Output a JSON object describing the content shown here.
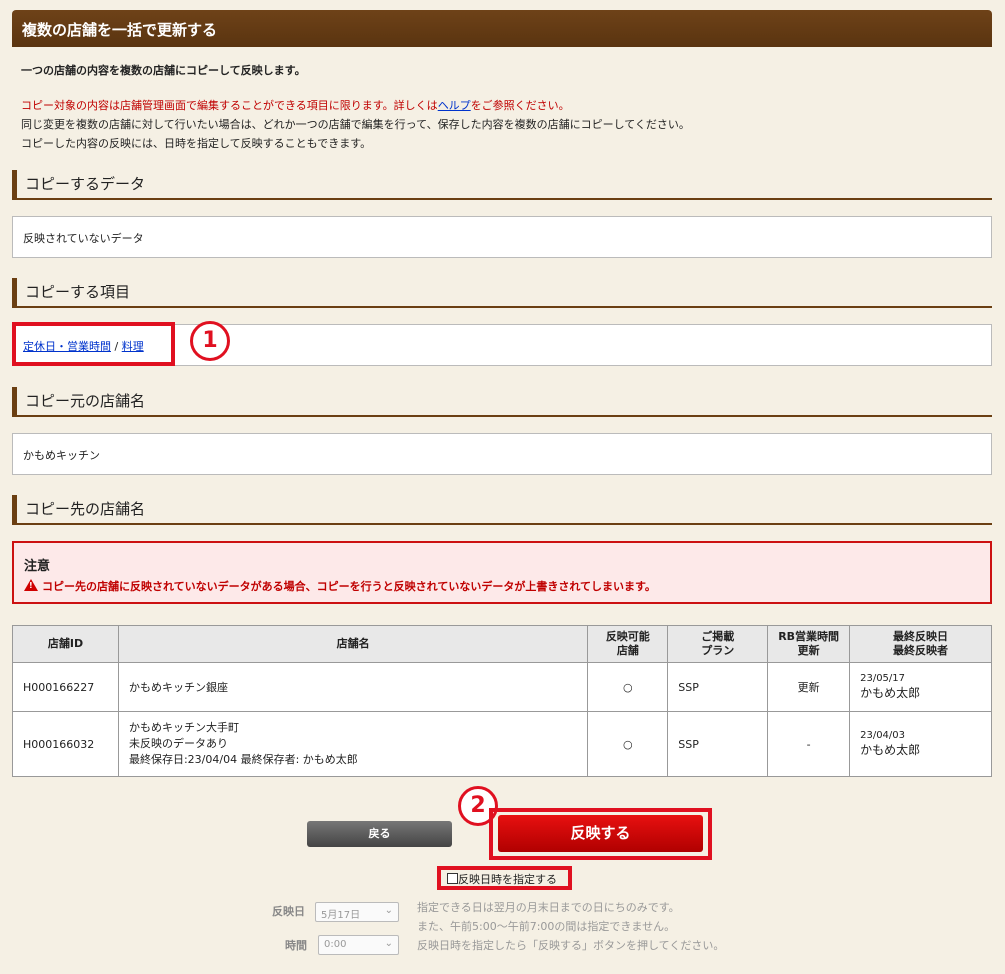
{
  "page": {
    "title": "複数の店舗を一括で更新する",
    "intro": "一つの店舗の内容を複数の店舗にコピーして反映します。",
    "note_red_1": "コピー対象の内容は店舗管理画面で編集することができる項目に限ります。詳しくは",
    "note_link": "ヘルプ",
    "note_red_2": "をご参照ください。",
    "note_2": "同じ変更を複数の店舗に対して行いたい場合は、どれか一つの店舗で編集を行って、保存した内容を複数の店舗にコピーしてください。",
    "note_3": "コピーした内容の反映には、日時を指定して反映することもできます。"
  },
  "sections": {
    "copy_data": {
      "heading": "コピーするデータ",
      "value": "反映されていないデータ"
    },
    "copy_items": {
      "heading": "コピーする項目",
      "link1": "定休日・営業時間",
      "sep": " / ",
      "link2": "料理"
    },
    "source_store": {
      "heading": "コピー元の店舗名",
      "value": "かもめキッチン"
    },
    "target_store": {
      "heading": "コピー先の店舗名"
    }
  },
  "caution": {
    "title": "注意",
    "message": "コピー先の店舗に反映されていないデータがある場合、コピーを行うと反映されていないデータが上書きされてしまいます。"
  },
  "table": {
    "headers": {
      "id": "店舗ID",
      "name": "店舗名",
      "reflectable_1": "反映可能",
      "reflectable_2": "店舗",
      "plan_1": "ご掲載",
      "plan_2": "プラン",
      "rb_1": "RB営業時間",
      "rb_2": "更新",
      "last_1": "最終反映日",
      "last_2": "最終反映者"
    },
    "rows": [
      {
        "id": "H000166227",
        "name": "かもめキッチン銀座",
        "name_sub1": "",
        "name_sub2": "",
        "reflectable": "○",
        "plan": "SSP",
        "rb": "更新",
        "last_date": "23/05/17",
        "last_user": "かもめ太郎"
      },
      {
        "id": "H000166032",
        "name": "かもめキッチン大手町",
        "name_sub1": "未反映のデータあり",
        "name_sub2": "最終保存日:23/04/04 最終保存者: かもめ太郎",
        "reflectable": "○",
        "plan": "SSP",
        "rb": "-",
        "last_date": "23/04/03",
        "last_user": "かもめ太郎"
      }
    ]
  },
  "annotations": {
    "one": "1",
    "two": "2"
  },
  "buttons": {
    "back": "戻る",
    "apply": "反映する"
  },
  "schedule": {
    "checkbox_label": "反映日時を指定する",
    "date_label": "反映日",
    "date_value": "5月17日",
    "time_label": "時間",
    "time_value": "0:00",
    "note1": "指定できる日は翌月の月末日までの日にちのみです。",
    "note2": "また、午前5:00〜午前7:00の間は指定できません。",
    "note3": "反映日時を指定したら「反映する」ボタンを押してください。"
  },
  "colors": {
    "brown": "#6b3f12",
    "red": "#e01020",
    "caution_bg": "#fde9e9"
  }
}
